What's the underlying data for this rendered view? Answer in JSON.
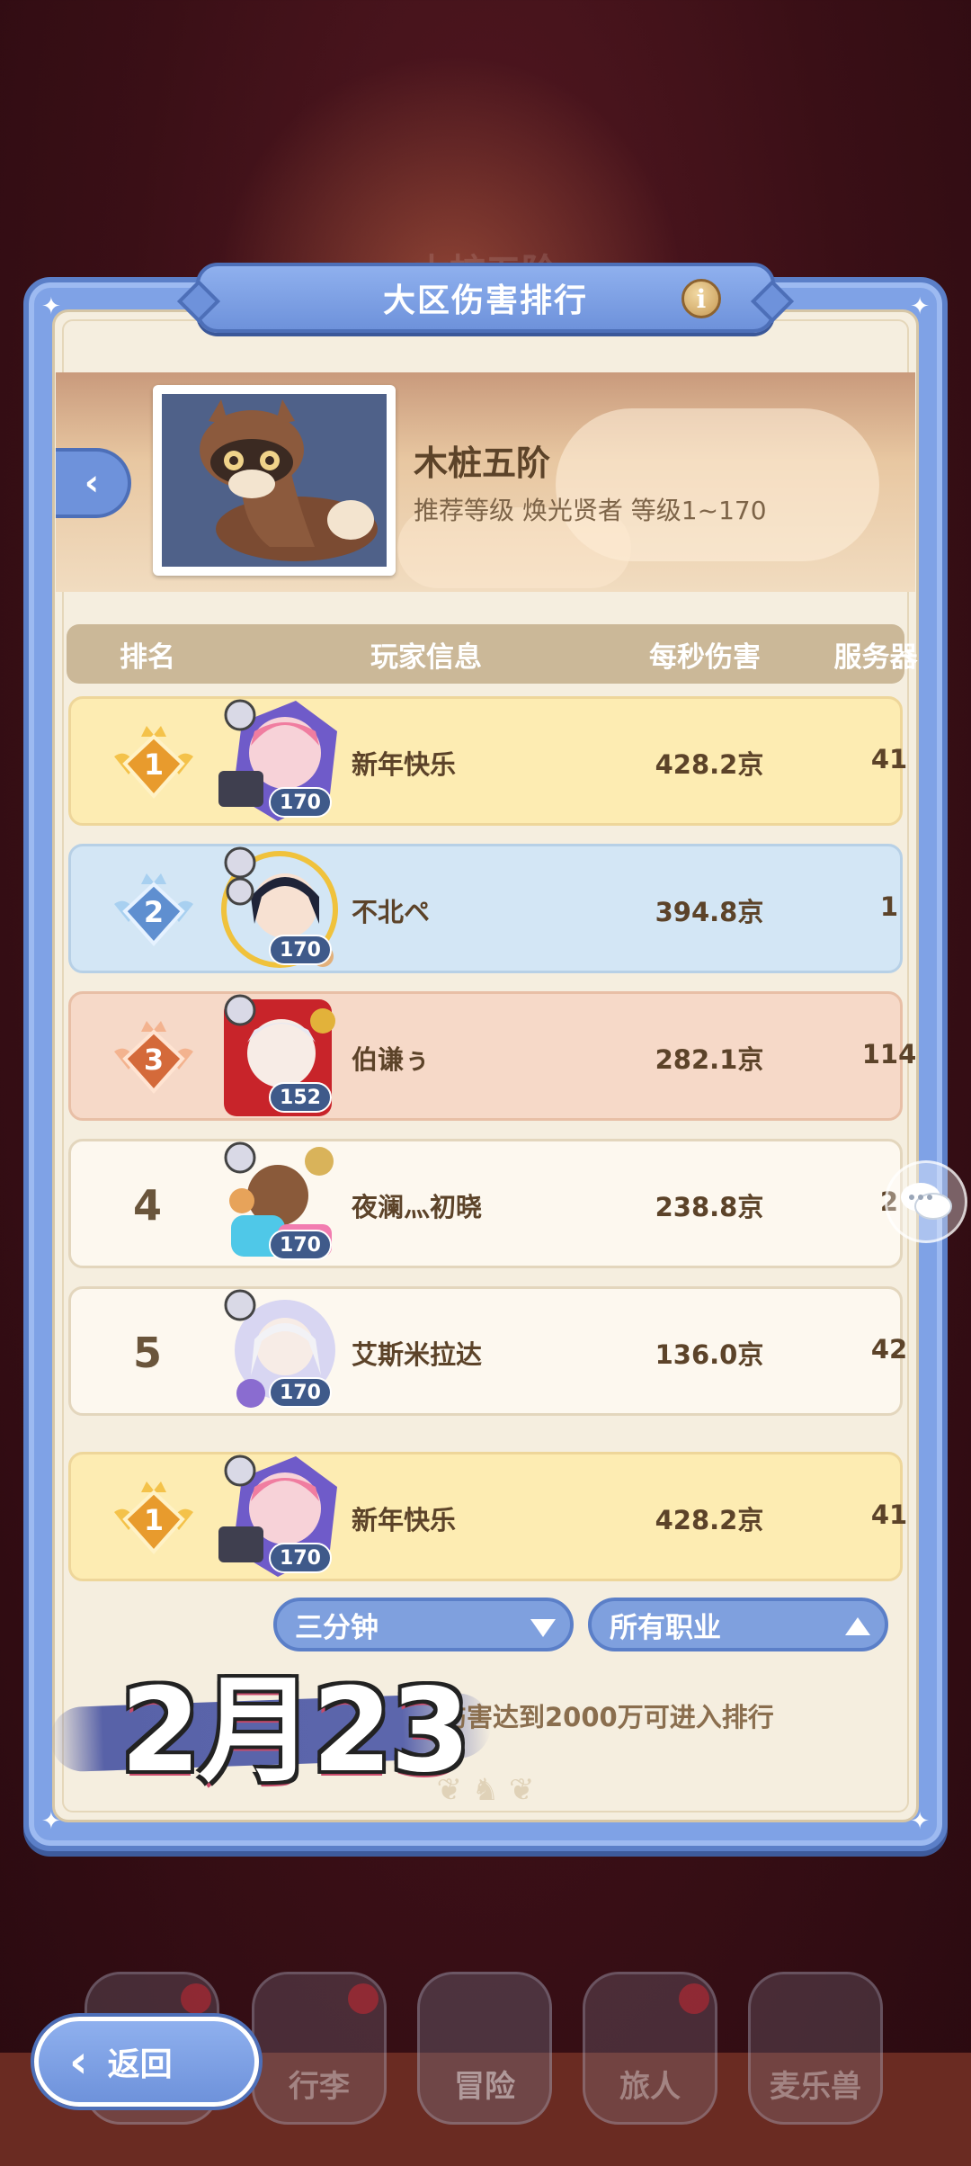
{
  "background": {
    "ghost_title": "木桩五阶"
  },
  "panel": {
    "title": "大区伤害排行",
    "info_icon": "i"
  },
  "boss": {
    "name": "木桩五阶",
    "subtitle": "推荐等级 焕光贤者  等级1~170",
    "back_icon": "‹"
  },
  "table": {
    "headers": {
      "rank": "排名",
      "player": "玩家信息",
      "dps": "每秒伤害",
      "server": "服务器"
    },
    "rows": [
      {
        "rank": "1",
        "name": "新年快乐",
        "level": "170",
        "dps": "428.2京",
        "server": "41",
        "tier": "gold"
      },
      {
        "rank": "2",
        "name": "不北ペ",
        "level": "170",
        "dps": "394.8京",
        "server": "1",
        "tier": "silver"
      },
      {
        "rank": "3",
        "name": "伯谦ぅ",
        "level": "152",
        "dps": "282.1京",
        "server": "114",
        "tier": "bronze"
      },
      {
        "rank": "4",
        "name": "夜澜灬初晓",
        "level": "170",
        "dps": "238.8京",
        "server": "2",
        "tier": "plain"
      },
      {
        "rank": "5",
        "name": "艾斯米拉达",
        "level": "170",
        "dps": "136.0京",
        "server": "42",
        "tier": "plain"
      }
    ],
    "self_row": {
      "rank": "1",
      "name": "新年快乐",
      "level": "170",
      "dps": "428.2京",
      "server": "41",
      "tier": "gold"
    }
  },
  "filters": {
    "time": "三分钟",
    "class": "所有职业"
  },
  "note": "伤害达到2000万可进入排行",
  "date_stamp": "2月23",
  "bottom_nav": [
    {
      "label": "",
      "icon": "castle-icon"
    },
    {
      "label": "行李",
      "icon": "bag-icon"
    },
    {
      "label": "冒险",
      "icon": "crossed-swords-icon"
    },
    {
      "label": "旅人",
      "icon": "traveler-icon"
    },
    {
      "label": "麦乐兽",
      "icon": "pet-icon"
    }
  ],
  "back_button": {
    "label": "返回"
  },
  "colors": {
    "panel_blue": "#7fa2e6",
    "gold_row": "#fdecb2",
    "silver_row": "#d3e6f5",
    "bronze_row": "#f6d9c8",
    "plain_row": "#fdf8ef"
  }
}
